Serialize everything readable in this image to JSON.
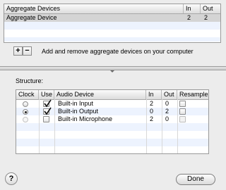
{
  "aggregate_table": {
    "headers": {
      "name": "Aggregate Devices",
      "in": "In",
      "out": "Out"
    },
    "rows": [
      {
        "name": "Aggregate Device",
        "in": "2",
        "out": "2",
        "selected": true
      }
    ]
  },
  "add_remove": {
    "add_label": "+",
    "remove_label": "−",
    "hint": "Add and remove aggregate devices on your computer"
  },
  "structure": {
    "label": "Structure:",
    "headers": {
      "clock": "Clock",
      "use": "Use",
      "device": "Audio Device",
      "in": "In",
      "out": "Out",
      "resample": "Resample"
    },
    "rows": [
      {
        "clock": "off",
        "use": true,
        "device": "Built-in Input",
        "in": "2",
        "out": "0",
        "resample": false
      },
      {
        "clock": "on",
        "use": true,
        "device": "Built-in Output",
        "in": "0",
        "out": "2",
        "resample": false
      },
      {
        "clock": "disabled",
        "use": false,
        "device": "Built-in Microphone",
        "in": "2",
        "out": "0",
        "resample": false
      }
    ]
  },
  "help_label": "?",
  "done_label": "Done",
  "colors": {
    "alt_row": "#edf3fe",
    "selected_row": "#d4d4d4",
    "window_bg": "#ececec"
  }
}
